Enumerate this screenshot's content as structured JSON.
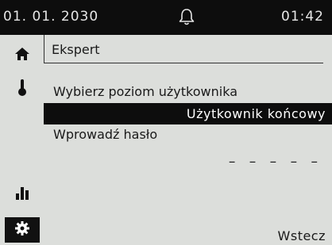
{
  "status_bar": {
    "date": "01. 01. 2030",
    "time": "01:42",
    "icon": "bell-icon"
  },
  "sidebar": {
    "items": [
      {
        "name": "home",
        "icon": "home-icon",
        "active": false
      },
      {
        "name": "temperature",
        "icon": "thermometer-icon",
        "active": false
      },
      {
        "name": "statistics",
        "icon": "bar-chart-icon",
        "active": false
      },
      {
        "name": "settings",
        "icon": "gear-icon",
        "active": true
      }
    ]
  },
  "main": {
    "section_title": "Ekspert",
    "user_level_label": "Wybierz poziom użytkownika",
    "user_level_value": "Użytkownik końcowy",
    "password_label": "Wprowadź hasło",
    "password_value": "– – – – –",
    "back_label": "Wstecz"
  },
  "colors": {
    "background": "#dcdedb",
    "bar": "#0d0d0d",
    "highlight_text": "#ffffff"
  }
}
